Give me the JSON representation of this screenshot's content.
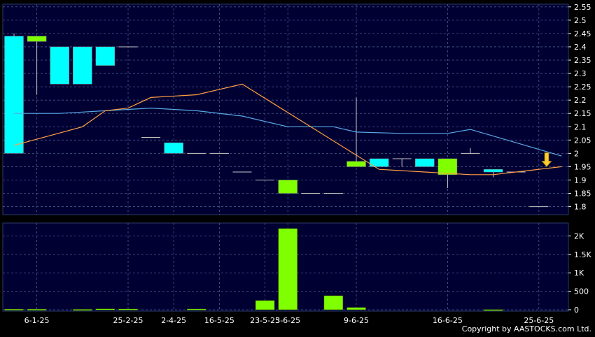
{
  "colors": {
    "background": "#000000",
    "plot_bg": "#000033",
    "grid": "#4a5a8a",
    "up_candle": "#00FFFF",
    "down_candle": "#80FF00",
    "ma_short": "#FFA040",
    "ma_long": "#5AA8E8",
    "volume_bar": "#80FF00",
    "text": "#FFFFFF",
    "arrow": "#FFCC33"
  },
  "copyright": "Copyright by AASTOCKS.com Ltd.",
  "chart_data": [
    {
      "type": "candlestick",
      "y_ticks": [
        "2.55",
        "2.5",
        "2.45",
        "2.4",
        "2.35",
        "2.3",
        "2.25",
        "2.2",
        "2.15",
        "2.1",
        "2.05",
        "2",
        "1.95",
        "1.9",
        "1.85",
        "1.8"
      ],
      "ylim": [
        1.77,
        2.56
      ],
      "x_ticks": [
        {
          "label": "6-1-25",
          "i": 1
        },
        {
          "label": "25-2-25",
          "i": 5
        },
        {
          "label": "2-4-25",
          "i": 7
        },
        {
          "label": "16-5-25",
          "i": 9
        },
        {
          "label": "23-5-25",
          "i": 11
        },
        {
          "label": "3-6-25",
          "i": 12
        },
        {
          "label": "9-6-25",
          "i": 15
        },
        {
          "label": "16-6-25",
          "i": 19
        },
        {
          "label": "25-6-25",
          "i": 23
        }
      ],
      "candles": [
        {
          "o": 2.0,
          "h": 2.45,
          "l": 2.0,
          "c": 2.44
        },
        {
          "o": 2.44,
          "h": 2.44,
          "l": 2.22,
          "c": 2.42
        },
        {
          "o": 2.26,
          "h": 2.4,
          "l": 2.26,
          "c": 2.4
        },
        {
          "o": 2.26,
          "h": 2.4,
          "l": 2.26,
          "c": 2.4
        },
        {
          "o": 2.33,
          "h": 2.4,
          "l": 2.33,
          "c": 2.4
        },
        {
          "o": 2.4,
          "h": 2.4,
          "l": 2.4,
          "c": 2.4
        },
        {
          "o": 2.06,
          "h": 2.06,
          "l": 2.06,
          "c": 2.06
        },
        {
          "o": 2.0,
          "h": 2.04,
          "l": 2.0,
          "c": 2.04
        },
        {
          "o": 2.0,
          "h": 2.0,
          "l": 2.0,
          "c": 2.0
        },
        {
          "o": 2.0,
          "h": 2.0,
          "l": 2.0,
          "c": 2.0
        },
        {
          "o": 1.93,
          "h": 1.93,
          "l": 1.93,
          "c": 1.93
        },
        {
          "o": 1.9,
          "h": 1.9,
          "l": 1.9,
          "c": 1.9
        },
        {
          "o": 1.9,
          "h": 1.9,
          "l": 1.85,
          "c": 1.85
        },
        {
          "o": 1.85,
          "h": 1.85,
          "l": 1.85,
          "c": 1.85
        },
        {
          "o": 1.85,
          "h": 1.85,
          "l": 1.85,
          "c": 1.85
        },
        {
          "o": 1.97,
          "h": 2.21,
          "l": 1.95,
          "c": 1.95
        },
        {
          "o": 1.95,
          "h": 1.98,
          "l": 1.95,
          "c": 1.98
        },
        {
          "o": 1.98,
          "h": 1.98,
          "l": 1.95,
          "c": 1.98
        },
        {
          "o": 1.95,
          "h": 1.98,
          "l": 1.95,
          "c": 1.98
        },
        {
          "o": 1.98,
          "h": 1.98,
          "l": 1.87,
          "c": 1.92
        },
        {
          "o": 2.0,
          "h": 2.02,
          "l": 2.0,
          "c": 2.0
        },
        {
          "o": 1.93,
          "h": 1.94,
          "l": 1.91,
          "c": 1.94
        },
        {
          "o": 1.93,
          "h": 1.93,
          "l": 1.93,
          "c": 1.93
        },
        {
          "o": 1.8,
          "h": 1.8,
          "l": 1.8,
          "c": 1.8
        }
      ],
      "ma_short": [
        {
          "i": 0,
          "v": 2.03
        },
        {
          "i": 3,
          "v": 2.1
        },
        {
          "i": 4,
          "v": 2.16
        },
        {
          "i": 5,
          "v": 2.17
        },
        {
          "i": 6,
          "v": 2.21
        },
        {
          "i": 8,
          "v": 2.22
        },
        {
          "i": 10,
          "v": 2.26
        },
        {
          "i": 13,
          "v": 2.1
        },
        {
          "i": 16,
          "v": 1.94
        },
        {
          "i": 18,
          "v": 1.93
        },
        {
          "i": 20,
          "v": 1.92
        },
        {
          "i": 21,
          "v": 1.92
        },
        {
          "i": 23,
          "v": 1.94
        },
        {
          "i": 24,
          "v": 1.95
        }
      ],
      "ma_long": [
        {
          "i": 0,
          "v": 2.15
        },
        {
          "i": 2,
          "v": 2.15
        },
        {
          "i": 4,
          "v": 2.16
        },
        {
          "i": 6,
          "v": 2.17
        },
        {
          "i": 8,
          "v": 2.16
        },
        {
          "i": 10,
          "v": 2.14
        },
        {
          "i": 12,
          "v": 2.1
        },
        {
          "i": 14,
          "v": 2.1
        },
        {
          "i": 15,
          "v": 2.08
        },
        {
          "i": 17,
          "v": 2.075
        },
        {
          "i": 19,
          "v": 2.075
        },
        {
          "i": 20,
          "v": 2.09
        },
        {
          "i": 22,
          "v": 2.04
        },
        {
          "i": 24,
          "v": 1.99
        }
      ]
    },
    {
      "type": "bar",
      "y_ticks": [
        "2K",
        "1.5K",
        "1K",
        "500",
        "0"
      ],
      "y_tick_values": [
        2000,
        1500,
        1000,
        500,
        0
      ],
      "ylim": [
        0,
        2350
      ],
      "volumes": [
        15,
        15,
        0,
        10,
        25,
        20,
        0,
        0,
        20,
        0,
        0,
        250,
        2200,
        0,
        380,
        60,
        0,
        0,
        0,
        0,
        0,
        5,
        0,
        0
      ]
    }
  ]
}
